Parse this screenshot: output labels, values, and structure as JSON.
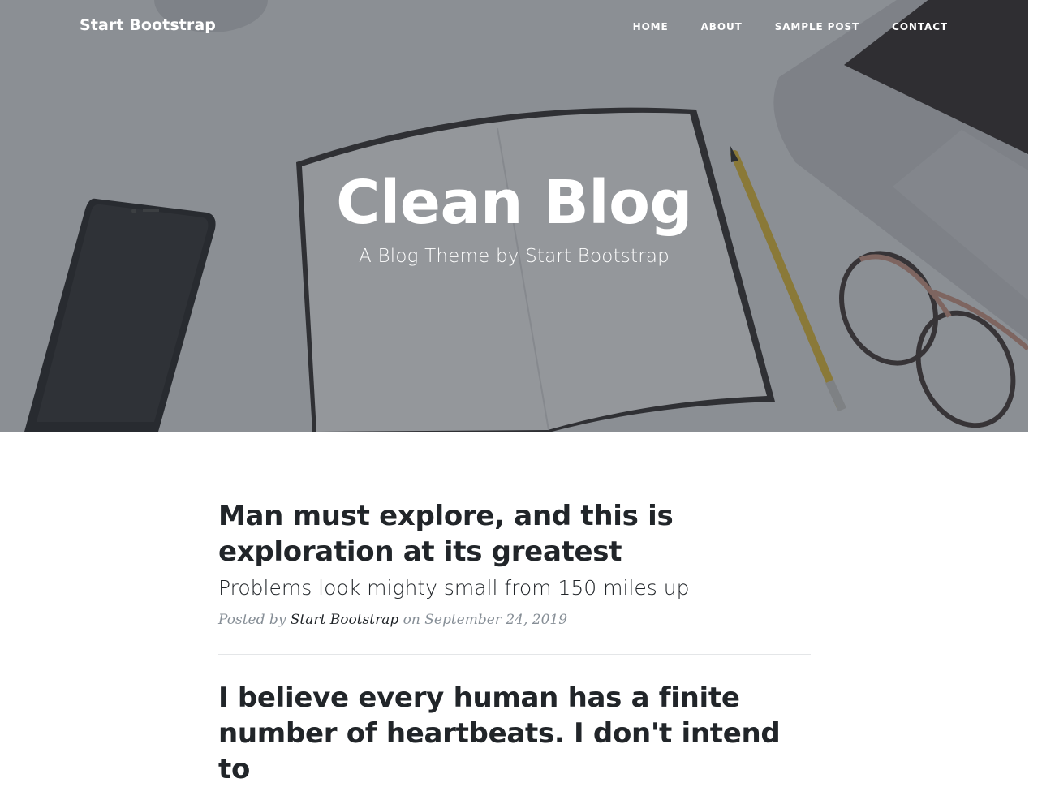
{
  "navbar": {
    "brand": "Start Bootstrap",
    "links": [
      "Home",
      "About",
      "Sample Post",
      "Contact"
    ]
  },
  "hero": {
    "title": "Clean Blog",
    "subtitle": "A Blog Theme by Start Bootstrap"
  },
  "posts": [
    {
      "title": "Man must explore, and this is exploration at its greatest",
      "subtitle": "Problems look mighty small from 150 miles up",
      "meta_prefix": "Posted by",
      "author": "Start Bootstrap",
      "meta_on": "on",
      "date": "September 24, 2019"
    },
    {
      "title": "I believe every human has a finite number of heartbeats. I don't intend to"
    }
  ],
  "colors": {
    "overlay": "#343a40",
    "text_dark": "#212529",
    "meta_gray": "#868e96",
    "divider": "#e4e6e8"
  }
}
